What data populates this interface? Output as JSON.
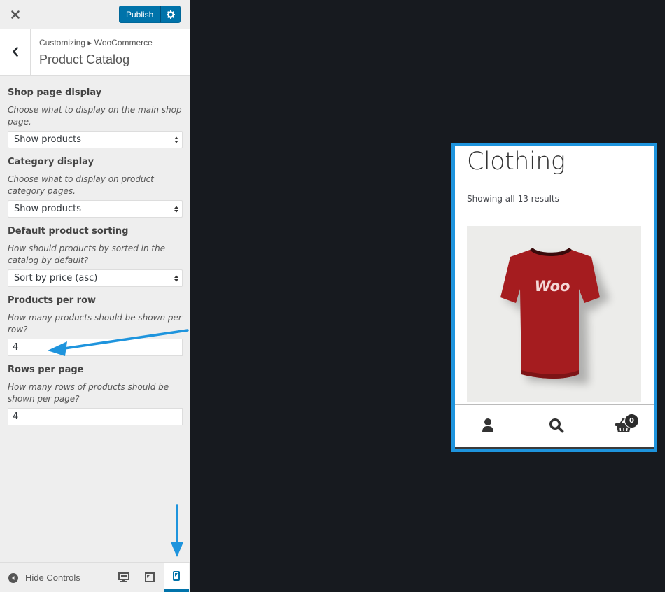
{
  "topbar": {
    "close_icon": "close-icon",
    "publish_label": "Publish",
    "settings_icon": "gear-icon"
  },
  "section": {
    "breadcrumb": "Customizing ▸ WooCommerce",
    "title": "Product Catalog"
  },
  "controls": {
    "shop_page_display": {
      "label": "Shop page display",
      "description": "Choose what to display on the main shop page.",
      "value": "Show products"
    },
    "category_display": {
      "label": "Category display",
      "description": "Choose what to display on product category pages.",
      "value": "Show products"
    },
    "default_sorting": {
      "label": "Default product sorting",
      "description": "How should products by sorted in the catalog by default?",
      "value": "Sort by price (asc)"
    },
    "products_per_row": {
      "label": "Products per row",
      "description": "How many products should be shown per row?",
      "value": "4"
    },
    "rows_per_page": {
      "label": "Rows per page",
      "description": "How many rows of products should be shown per page?",
      "value": "4"
    }
  },
  "footer": {
    "hide_controls_label": "Hide Controls",
    "devices": [
      "desktop-icon",
      "tablet-icon",
      "mobile-icon"
    ],
    "active_device": "mobile"
  },
  "preview": {
    "heading": "Clothing",
    "result_count": "Showing all 13 results",
    "product_print": "Woo",
    "cart_count": "0"
  },
  "colors": {
    "accent": "#0073aa",
    "annotation": "#1e94dd",
    "preview_bg": "#171a1f",
    "tshirt": "#a51c1f"
  }
}
